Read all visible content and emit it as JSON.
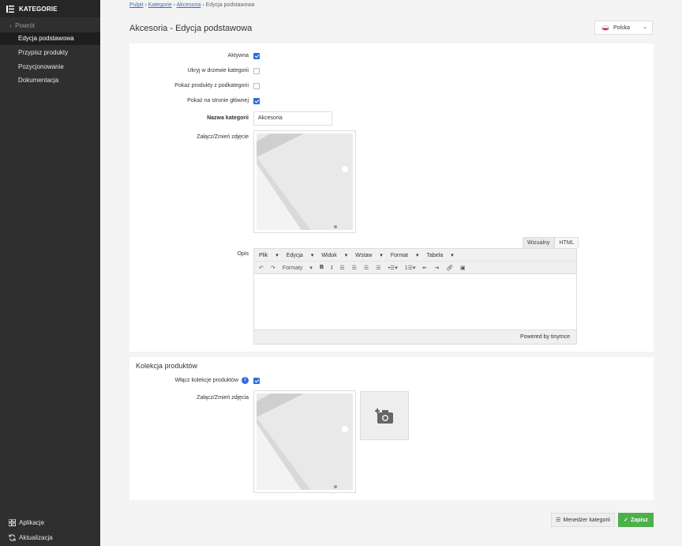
{
  "sidebar": {
    "header": "KATEGORIE",
    "back": "Powrót",
    "items": [
      "Edycja podstawowa",
      "Przypisz produkty",
      "Pozycjonowanie",
      "Dokumentacja"
    ],
    "active_index": 0,
    "bottom": {
      "apps": "Aplikacje",
      "updates": "Aktualizacja"
    }
  },
  "breadcrumb": {
    "home": "Pulpit",
    "categories": "Kategorie",
    "current_cat": "Akcesoria",
    "page": "Edycja podstawowa",
    "sep": "›"
  },
  "page_title": "Akcesoria - Edycja podstawowa",
  "language": {
    "label": "Polska"
  },
  "form": {
    "active_label": "Aktywna",
    "active": true,
    "hide_label": "Ukryj w drzewie kategorii",
    "hide": false,
    "show_sub_label": "Pokaż produkty z podkategorii",
    "show_sub": false,
    "show_home_label": "Pokaż na stronie głównej",
    "show_home": true,
    "name_label": "Nazwa kategorii",
    "name_value": "Akcesoria",
    "image_label": "Załącz/Zmień zdjęcie",
    "desc_label": "Opis"
  },
  "editor": {
    "tabs": [
      "Wizualny",
      "HTML"
    ],
    "menus": [
      "Plik",
      "Edycja",
      "Widok",
      "Wstaw",
      "Format",
      "Tabela"
    ],
    "formats": "Formaty",
    "powered": "Powered by tinymce"
  },
  "collection": {
    "title": "Kolekcja produktów",
    "enable_label": "Włącz kolekcje produktów",
    "enabled": true,
    "images_label": "Załącz/Zmień zdjęcia"
  },
  "actions": {
    "manager": "Menedżer kategorii",
    "save": "Zapisz"
  },
  "colors": {
    "sidebar": "#2f2f2f",
    "accent": "#2f6fd6",
    "save": "#4db04a"
  }
}
